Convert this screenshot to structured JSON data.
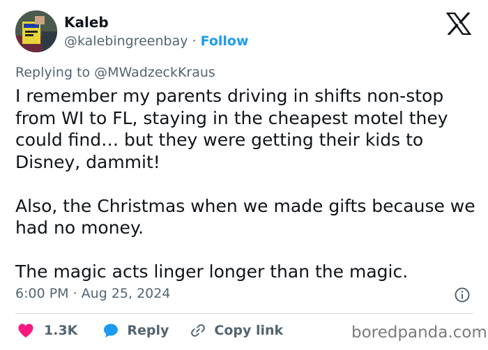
{
  "author": {
    "name": "Kaleb",
    "handle": "@kalebingreenbay",
    "separator": "·",
    "follow_label": "Follow"
  },
  "reply": {
    "prefix": "Replying to",
    "target": "@MWadzeckKraus"
  },
  "tweet": {
    "paragraphs": [
      "I remember my parents driving in shifts non-stop from WI to FL, staying in the cheapest motel they could find… but they were getting their kids to Disney, dammit!",
      "Also, the Christmas when we made gifts because we had no money.",
      "The magic acts linger longer than the magic."
    ],
    "timestamp": "6:00 PM · Aug 25, 2024"
  },
  "actions": {
    "likes": "1.3K",
    "reply_label": "Reply",
    "copy_label": "Copy link"
  },
  "watermark": "boredpanda.com",
  "icons": {
    "brand": "x-logo-icon",
    "info": "info-icon",
    "like": "heart-icon",
    "reply": "speech-bubble-icon",
    "copy": "link-icon"
  },
  "colors": {
    "link": "#1d9bf0",
    "like": "#f91880",
    "secondary_text": "#536471",
    "primary_text": "#0f1419"
  }
}
